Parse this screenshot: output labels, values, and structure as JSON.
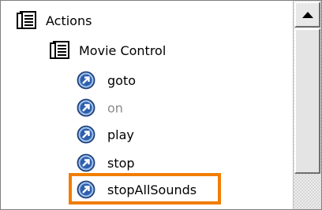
{
  "tree": {
    "root": {
      "label": "Actions",
      "icon": "book-icon"
    },
    "folder": {
      "label": "Movie Control",
      "icon": "book-icon"
    },
    "items": [
      {
        "label": "goto",
        "icon": "action-arrow-icon",
        "dimmed": false
      },
      {
        "label": "on",
        "icon": "action-arrow-icon",
        "dimmed": true
      },
      {
        "label": "play",
        "icon": "action-arrow-icon",
        "dimmed": false
      },
      {
        "label": "stop",
        "icon": "action-arrow-icon",
        "dimmed": false
      },
      {
        "label": "stopAllSounds",
        "icon": "action-arrow-icon",
        "dimmed": false,
        "highlighted": true
      }
    ]
  },
  "scrollbar": {
    "up_icon": "scroll-up-arrow-icon"
  },
  "colors": {
    "highlight": "#f07d00",
    "action_icon": "#2f5fae",
    "dimmed_text": "#8a8a8a"
  }
}
